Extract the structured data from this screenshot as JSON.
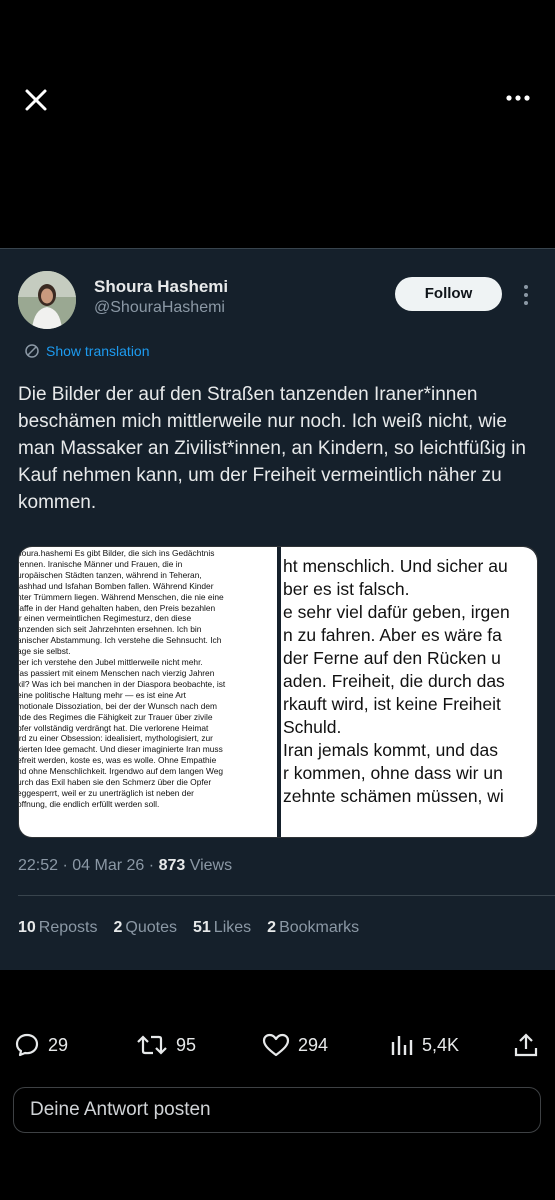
{
  "tweet": {
    "display_name": "Shoura Hashemi",
    "handle": "@ShouraHashemi",
    "follow_label": "Follow",
    "translate_label": "Show translation",
    "text": "Die Bilder der auf den Straßen tanzenden Iraner*innen beschämen mich mittlerweile nur noch. Ich weiß nicht, wie man Massaker an Zivilist*innen, an Kindern, so leichtfüßig in Kauf nehmen kann, um der Freiheit vermeintlich näher zu kommen.",
    "time": "22:52",
    "date": "04 Mar 26",
    "views_count": "873",
    "views_label": "Views"
  },
  "media": {
    "left_lines": [
      "houra.hashemi Es gibt Bilder, die sich ins Gedächtnis",
      "rennen. Iranische Männer und Frauen, die in",
      "uropäischen Städten tanzen, während in Teheran,",
      "lashhad und Isfahan Bomben fallen. Während Kinder",
      "nter Trümmern liegen. Während Menschen, die nie eine",
      "/affe in der Hand gehalten haben, den Preis bezahlen",
      "ir einen vermeintlichen Regimesturz, den diese",
      "anzenden sich seit Jahrzehnten ersehnen. Ich bin",
      "anischer Abstammung. Ich verstehe die Sehnsucht. Ich",
      "age sie selbst.",
      "ber ich verstehe den Jubel mittlerweile nicht mehr.",
      "/as passiert mit einem Menschen nach vierzig Jahren",
      "xil? Was ich bei manchen in der Diaspora beobachte, ist",
      "eine politische Haltung mehr — es ist eine Art",
      "motionale Dissoziation, bei der der Wunsch nach dem",
      "nde des Regimes die Fähigkeit zur Trauer über zivile",
      "pfer vollständig verdrängt hat. Die verlorene Heimat",
      "ird zu einer Obsession: idealisiert, mythologisiert, zur",
      "xierten Idee gemacht. Und dieser imaginierte Iran muss",
      "efreit werden, koste es, was es wolle. Ohne Empathie",
      "nd ohne Menschlichkeit. Irgendwo auf dem langen Weg",
      "urch das Exil haben sie den Schmerz über die Opfer",
      "eggesperrt, weil er zu unerträglich ist neben der",
      "offnung, die endlich erfüllt werden soll."
    ],
    "right_lines": [
      "ht menschlich. Und sicher au",
      "ber es ist falsch.",
      "e sehr viel dafür geben, irgen",
      "n zu fahren. Aber es wäre fa",
      "der Ferne auf den Rücken u",
      "aden. Freiheit, die durch das",
      "rkauft wird, ist keine Freiheit",
      "Schuld.",
      "Iran jemals kommt, und das",
      "r kommen, ohne dass wir un",
      "zehnte schämen müssen, wi"
    ]
  },
  "stats": [
    {
      "count": "10",
      "label": "Reposts"
    },
    {
      "count": "2",
      "label": "Quotes"
    },
    {
      "count": "51",
      "label": "Likes"
    },
    {
      "count": "2",
      "label": "Bookmarks"
    }
  ],
  "actions": {
    "replies": "29",
    "reposts": "95",
    "likes": "294",
    "views": "5,4K"
  },
  "reply_placeholder": "Deine Antwort posten",
  "colors": {
    "background": "#15202b",
    "accent": "#1d9bf0",
    "secondary_text": "#8b98a5"
  }
}
